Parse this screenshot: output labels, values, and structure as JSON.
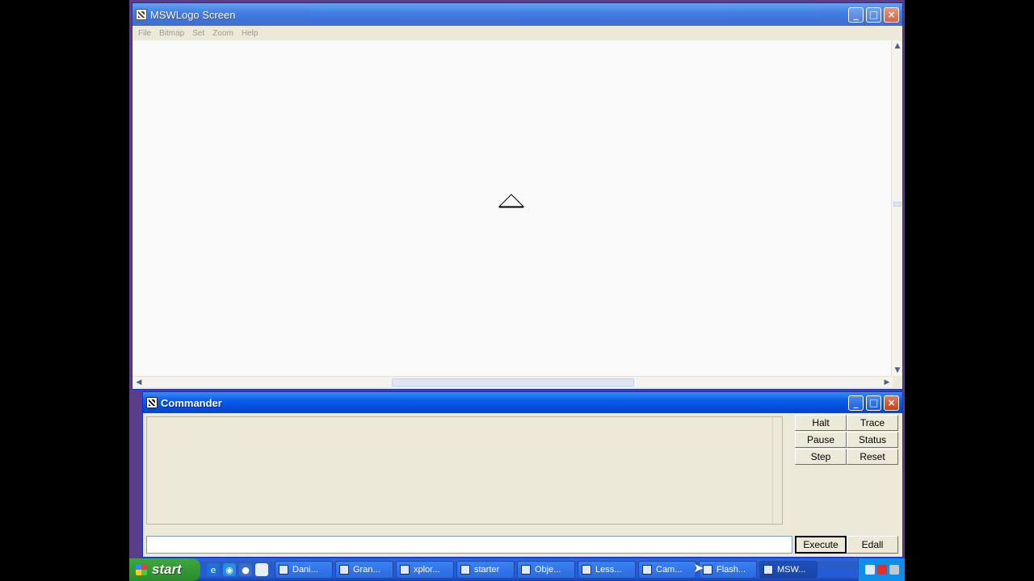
{
  "main_window": {
    "title": "MSWLogo Screen",
    "menu": [
      "File",
      "Bitmap",
      "Set",
      "Zoom",
      "Help"
    ]
  },
  "commander": {
    "title": "Commander",
    "input_value": "",
    "buttons": [
      "Halt",
      "Trace",
      "Pause",
      "Status",
      "Step",
      "Reset"
    ],
    "execute_label": "Execute",
    "edall_label": "Edall"
  },
  "taskbar": {
    "start_label": "start",
    "tasks": [
      "Dani...",
      "Gran...",
      "xplor...",
      "starter",
      "Obje...",
      "Less...",
      "Cam...",
      "Flash...",
      "MSW..."
    ],
    "active_task_index": 8
  },
  "colors": {
    "titlebar": "#0a5de8",
    "canvas": "#f9f9f9",
    "desktop": "#5a3d8a"
  }
}
